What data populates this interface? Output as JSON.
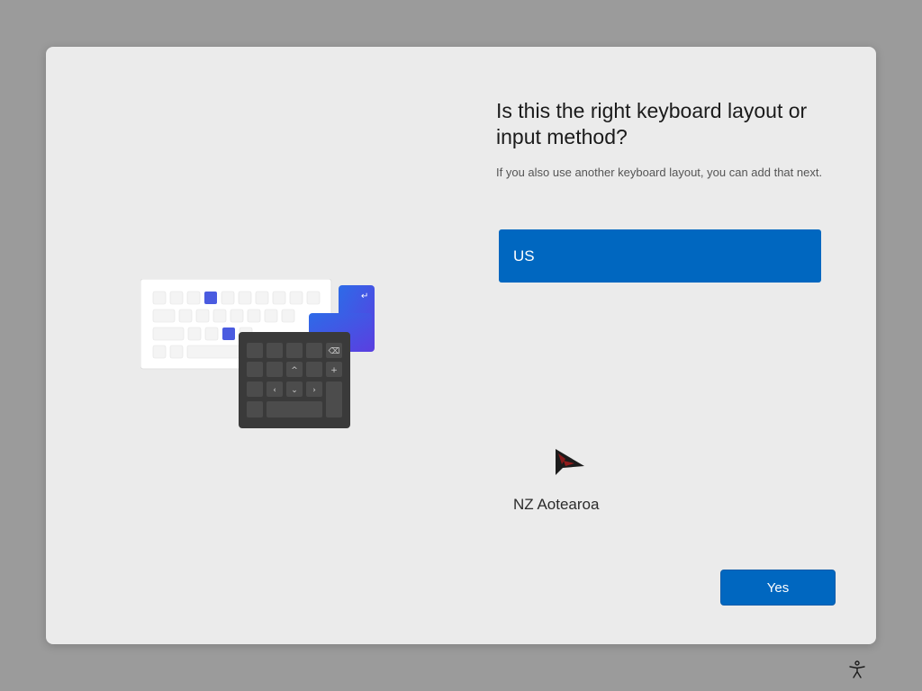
{
  "page": {
    "title": "Is this the right keyboard layout or input method?",
    "subtitle": "If you also use another keyboard layout, you can add that next."
  },
  "layouts": [
    {
      "label": "US",
      "selected": true
    },
    {
      "label": "NZ Aotearoa",
      "selected": false
    }
  ],
  "actions": {
    "yes_label": "Yes"
  },
  "icons": {
    "illustration": "keyboard-illustration-icon",
    "accessibility": "accessibility-icon",
    "cursor": "mouse-pointer-icon"
  },
  "colors": {
    "accent": "#0067c0",
    "illustration_highlight": "#4a5be0"
  }
}
